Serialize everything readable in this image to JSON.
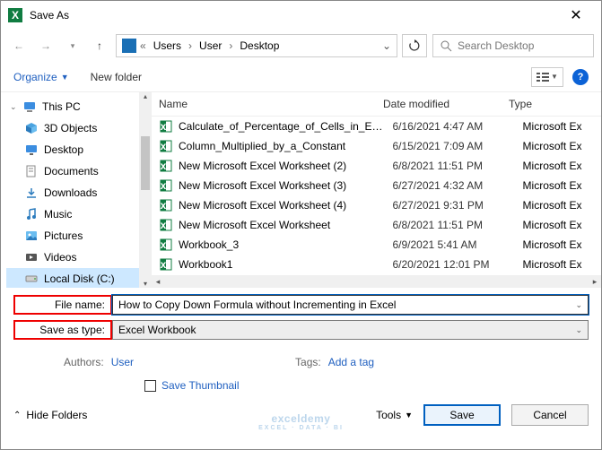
{
  "title": "Save As",
  "breadcrumbs": [
    "Users",
    "User",
    "Desktop"
  ],
  "search_placeholder": "Search Desktop",
  "toolbar": {
    "organize": "Organize",
    "new_folder": "New folder"
  },
  "tree": {
    "items": [
      {
        "label": "This PC",
        "icon": "pc"
      },
      {
        "label": "3D Objects",
        "icon": "3d"
      },
      {
        "label": "Desktop",
        "icon": "desktop"
      },
      {
        "label": "Documents",
        "icon": "docs"
      },
      {
        "label": "Downloads",
        "icon": "downloads"
      },
      {
        "label": "Music",
        "icon": "music"
      },
      {
        "label": "Pictures",
        "icon": "pictures"
      },
      {
        "label": "Videos",
        "icon": "videos"
      },
      {
        "label": "Local Disk (C:)",
        "icon": "disk"
      }
    ]
  },
  "columns": {
    "name": "Name",
    "date": "Date modified",
    "type": "Type"
  },
  "files": [
    {
      "name": "Calculate_of_Percentage_of_Cells_in_Excel",
      "date": "6/16/2021 4:47 AM",
      "type": "Microsoft Ex"
    },
    {
      "name": "Column_Multiplied_by_a_Constant",
      "date": "6/15/2021 7:09 AM",
      "type": "Microsoft Ex"
    },
    {
      "name": "New Microsoft Excel Worksheet (2)",
      "date": "6/8/2021 11:51 PM",
      "type": "Microsoft Ex"
    },
    {
      "name": "New Microsoft Excel Worksheet (3)",
      "date": "6/27/2021 4:32 AM",
      "type": "Microsoft Ex"
    },
    {
      "name": "New Microsoft Excel Worksheet (4)",
      "date": "6/27/2021 9:31 PM",
      "type": "Microsoft Ex"
    },
    {
      "name": "New Microsoft Excel Worksheet",
      "date": "6/8/2021 11:51 PM",
      "type": "Microsoft Ex"
    },
    {
      "name": "Workbook_3",
      "date": "6/9/2021 5:41 AM",
      "type": "Microsoft Ex"
    },
    {
      "name": "Workbook1",
      "date": "6/20/2021 12:01 PM",
      "type": "Microsoft Ex"
    }
  ],
  "form": {
    "filename_label": "File name:",
    "filename_value": "How to Copy Down Formula without Incrementing in Excel",
    "savetype_label": "Save as type:",
    "savetype_value": "Excel Workbook",
    "authors_label": "Authors:",
    "authors_value": "User",
    "tags_label": "Tags:",
    "tags_value": "Add a tag",
    "save_thumbnail": "Save Thumbnail"
  },
  "footer": {
    "hide_folders": "Hide Folders",
    "tools": "Tools",
    "save": "Save",
    "cancel": "Cancel"
  },
  "watermark": {
    "main": "exceldemy",
    "sub": "EXCEL · DATA · BI"
  },
  "help": "?"
}
